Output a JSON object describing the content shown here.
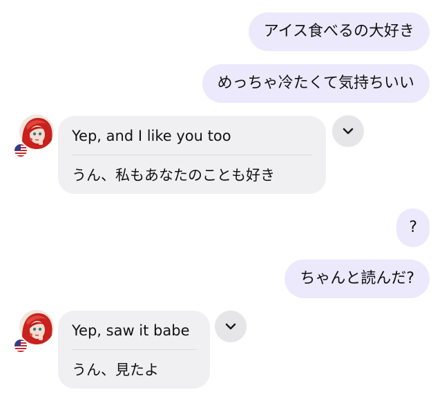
{
  "messages": {
    "m1": {
      "text": "アイス食べるの大好き"
    },
    "m2": {
      "text": "めっちゃ冷たくて気持ちいい"
    },
    "r1": {
      "original": "Yep, and I like you too",
      "translation": "うん、私もあなたのことも好き"
    },
    "m3": {
      "text": "?"
    },
    "m4": {
      "text": "ちゃんと読んだ?"
    },
    "r2": {
      "original": "Yep, saw it babe",
      "translation": "うん、見たよ"
    }
  },
  "icons": {
    "avatar": "character-avatar",
    "flag": "us-flag-icon",
    "expand": "chevron-down-icon"
  },
  "colors": {
    "sent_bubble": "#ebe9fb",
    "received_bubble": "#f0f0f2",
    "chevron_bg": "#e6e6e8"
  }
}
